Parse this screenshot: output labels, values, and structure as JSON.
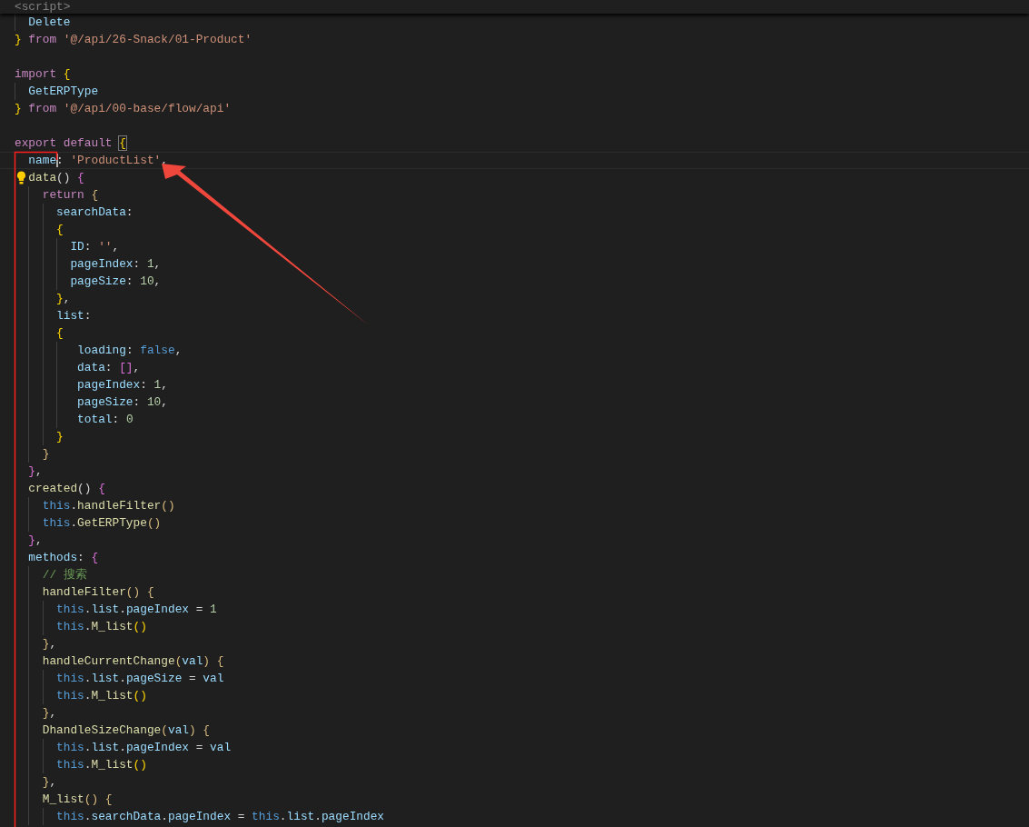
{
  "sticky_header": {
    "t": [
      {
        "kind": "tag",
        "text": "<script>"
      }
    ]
  },
  "lines": [
    {
      "current": false,
      "t": [
        {
          "kind": "property",
          "text": "  Delete"
        }
      ]
    },
    {
      "current": false,
      "t": [
        {
          "kind": "bracket1",
          "text": "}"
        },
        {
          "kind": "keyword",
          "text": " from"
        },
        {
          "kind": "string",
          "text": " '@/api/26-Snack/01-Product'"
        }
      ]
    },
    {
      "current": false
    },
    {
      "current": false,
      "t": [
        {
          "kind": "keyword",
          "text": "import"
        },
        {
          "kind": "bracket1",
          "text": " {"
        }
      ]
    },
    {
      "current": false,
      "t": [
        {
          "kind": "property",
          "text": "  GetERPType"
        }
      ]
    },
    {
      "current": false,
      "t": [
        {
          "kind": "bracket1",
          "text": "}"
        },
        {
          "kind": "keyword",
          "text": " from"
        },
        {
          "kind": "string",
          "text": " '@/api/00-base/flow/api'"
        }
      ]
    },
    {
      "current": false
    },
    {
      "current": false,
      "t": [
        {
          "kind": "keyword",
          "text": "export default "
        },
        {
          "kind": "bracket1",
          "text": "{",
          "match": true
        }
      ]
    },
    {
      "current": true,
      "t": [
        {
          "kind": "property",
          "text": "  name",
          "cursor": true
        },
        {
          "kind": "plain",
          "text": ":"
        },
        {
          "kind": "string",
          "text": " 'ProductList'"
        },
        {
          "kind": "plain",
          "text": ","
        }
      ]
    },
    {
      "current": false,
      "lightbulb": true,
      "t": [
        {
          "kind": "function",
          "text": "  data"
        },
        {
          "kind": "plain",
          "text": "()"
        },
        {
          "kind": "bracket2",
          "text": " {"
        }
      ]
    },
    {
      "current": false,
      "t": [
        {
          "kind": "keyword",
          "text": "    return"
        },
        {
          "kind": "bracket3",
          "text": " {"
        }
      ]
    },
    {
      "current": false,
      "t": [
        {
          "kind": "property",
          "text": "      searchData"
        },
        {
          "kind": "plain",
          "text": ":"
        }
      ]
    },
    {
      "current": false,
      "t": [
        {
          "kind": "bracket1",
          "text": "      {"
        }
      ]
    },
    {
      "current": false,
      "t": [
        {
          "kind": "property",
          "text": "        ID"
        },
        {
          "kind": "plain",
          "text": ":"
        },
        {
          "kind": "string",
          "text": " ''"
        },
        {
          "kind": "plain",
          "text": ","
        }
      ]
    },
    {
      "current": false,
      "t": [
        {
          "kind": "property",
          "text": "        pageIndex"
        },
        {
          "kind": "plain",
          "text": ":"
        },
        {
          "kind": "number",
          "text": " 1"
        },
        {
          "kind": "plain",
          "text": ","
        }
      ]
    },
    {
      "current": false,
      "t": [
        {
          "kind": "property",
          "text": "        pageSize"
        },
        {
          "kind": "plain",
          "text": ":"
        },
        {
          "kind": "number",
          "text": " 10"
        },
        {
          "kind": "plain",
          "text": ","
        }
      ]
    },
    {
      "current": false,
      "t": [
        {
          "kind": "bracket1",
          "text": "      }"
        },
        {
          "kind": "plain",
          "text": ","
        }
      ]
    },
    {
      "current": false,
      "t": [
        {
          "kind": "property",
          "text": "      list"
        },
        {
          "kind": "plain",
          "text": ":"
        }
      ]
    },
    {
      "current": false,
      "t": [
        {
          "kind": "bracket1",
          "text": "      {"
        }
      ]
    },
    {
      "current": false,
      "t": [
        {
          "kind": "property",
          "text": "         loading"
        },
        {
          "kind": "plain",
          "text": ":"
        },
        {
          "kind": "constant",
          "text": " false"
        },
        {
          "kind": "plain",
          "text": ","
        }
      ]
    },
    {
      "current": false,
      "t": [
        {
          "kind": "property",
          "text": "         data"
        },
        {
          "kind": "plain",
          "text": ":"
        },
        {
          "kind": "bracket2",
          "text": " []"
        },
        {
          "kind": "plain",
          "text": ","
        }
      ]
    },
    {
      "current": false,
      "t": [
        {
          "kind": "property",
          "text": "         pageIndex"
        },
        {
          "kind": "plain",
          "text": ":"
        },
        {
          "kind": "number",
          "text": " 1"
        },
        {
          "kind": "plain",
          "text": ","
        }
      ]
    },
    {
      "current": false,
      "t": [
        {
          "kind": "property",
          "text": "         pageSize"
        },
        {
          "kind": "plain",
          "text": ":"
        },
        {
          "kind": "number",
          "text": " 10"
        },
        {
          "kind": "plain",
          "text": ","
        }
      ]
    },
    {
      "current": false,
      "t": [
        {
          "kind": "property",
          "text": "         total"
        },
        {
          "kind": "plain",
          "text": ":"
        },
        {
          "kind": "number",
          "text": " 0"
        }
      ]
    },
    {
      "current": false,
      "t": [
        {
          "kind": "bracket1",
          "text": "      }"
        }
      ]
    },
    {
      "current": false,
      "t": [
        {
          "kind": "bracket3",
          "text": "    }"
        }
      ]
    },
    {
      "current": false,
      "t": [
        {
          "kind": "bracket2",
          "text": "  }"
        },
        {
          "kind": "plain",
          "text": ","
        }
      ]
    },
    {
      "current": false,
      "t": [
        {
          "kind": "function",
          "text": "  created"
        },
        {
          "kind": "plain",
          "text": "()"
        },
        {
          "kind": "bracket2",
          "text": " {"
        }
      ]
    },
    {
      "current": false,
      "t": [
        {
          "kind": "constant",
          "text": "    this"
        },
        {
          "kind": "plain",
          "text": "."
        },
        {
          "kind": "function",
          "text": "handleFilter"
        },
        {
          "kind": "bracket3",
          "text": "()"
        }
      ]
    },
    {
      "current": false,
      "t": [
        {
          "kind": "constant",
          "text": "    this"
        },
        {
          "kind": "plain",
          "text": "."
        },
        {
          "kind": "function",
          "text": "GetERPType"
        },
        {
          "kind": "bracket3",
          "text": "()"
        }
      ]
    },
    {
      "current": false,
      "t": [
        {
          "kind": "bracket2",
          "text": "  }"
        },
        {
          "kind": "plain",
          "text": ","
        }
      ]
    },
    {
      "current": false,
      "t": [
        {
          "kind": "property",
          "text": "  methods"
        },
        {
          "kind": "plain",
          "text": ":"
        },
        {
          "kind": "bracket2",
          "text": " {"
        }
      ]
    },
    {
      "current": false,
      "t": [
        {
          "kind": "comment",
          "text": "    // 搜索"
        }
      ]
    },
    {
      "current": false,
      "t": [
        {
          "kind": "function",
          "text": "    handleFilter"
        },
        {
          "kind": "bracket3",
          "text": "()"
        },
        {
          "kind": "bracket3",
          "text": " {"
        }
      ]
    },
    {
      "current": false,
      "t": [
        {
          "kind": "constant",
          "text": "      this"
        },
        {
          "kind": "plain",
          "text": "."
        },
        {
          "kind": "property",
          "text": "list"
        },
        {
          "kind": "plain",
          "text": "."
        },
        {
          "kind": "property",
          "text": "pageIndex"
        },
        {
          "kind": "plain",
          "text": " ="
        },
        {
          "kind": "number",
          "text": " 1"
        }
      ]
    },
    {
      "current": false,
      "t": [
        {
          "kind": "constant",
          "text": "      this"
        },
        {
          "kind": "plain",
          "text": "."
        },
        {
          "kind": "function",
          "text": "M_list"
        },
        {
          "kind": "bracket1",
          "text": "()"
        }
      ]
    },
    {
      "current": false,
      "t": [
        {
          "kind": "bracket3",
          "text": "    }"
        },
        {
          "kind": "plain",
          "text": ","
        }
      ]
    },
    {
      "current": false,
      "t": [
        {
          "kind": "function",
          "text": "    handleCurrentChange"
        },
        {
          "kind": "bracket3",
          "text": "("
        },
        {
          "kind": "property",
          "text": "val"
        },
        {
          "kind": "bracket3",
          "text": ")"
        },
        {
          "kind": "bracket3",
          "text": " {"
        }
      ]
    },
    {
      "current": false,
      "t": [
        {
          "kind": "constant",
          "text": "      this"
        },
        {
          "kind": "plain",
          "text": "."
        },
        {
          "kind": "property",
          "text": "list"
        },
        {
          "kind": "plain",
          "text": "."
        },
        {
          "kind": "property",
          "text": "pageSize"
        },
        {
          "kind": "plain",
          "text": " ="
        },
        {
          "kind": "property",
          "text": " val"
        }
      ]
    },
    {
      "current": false,
      "t": [
        {
          "kind": "constant",
          "text": "      this"
        },
        {
          "kind": "plain",
          "text": "."
        },
        {
          "kind": "function",
          "text": "M_list"
        },
        {
          "kind": "bracket1",
          "text": "()"
        }
      ]
    },
    {
      "current": false,
      "t": [
        {
          "kind": "bracket3",
          "text": "    }"
        },
        {
          "kind": "plain",
          "text": ","
        }
      ]
    },
    {
      "current": false,
      "t": [
        {
          "kind": "function",
          "text": "    DhandleSizeChange"
        },
        {
          "kind": "bracket3",
          "text": "("
        },
        {
          "kind": "property",
          "text": "val"
        },
        {
          "kind": "bracket3",
          "text": ")"
        },
        {
          "kind": "bracket3",
          "text": " {"
        }
      ]
    },
    {
      "current": false,
      "t": [
        {
          "kind": "constant",
          "text": "      this"
        },
        {
          "kind": "plain",
          "text": "."
        },
        {
          "kind": "property",
          "text": "list"
        },
        {
          "kind": "plain",
          "text": "."
        },
        {
          "kind": "property",
          "text": "pageIndex"
        },
        {
          "kind": "plain",
          "text": " ="
        },
        {
          "kind": "property",
          "text": " val"
        }
      ]
    },
    {
      "current": false,
      "t": [
        {
          "kind": "constant",
          "text": "      this"
        },
        {
          "kind": "plain",
          "text": "."
        },
        {
          "kind": "function",
          "text": "M_list"
        },
        {
          "kind": "bracket1",
          "text": "()"
        }
      ]
    },
    {
      "current": false,
      "t": [
        {
          "kind": "bracket3",
          "text": "    }"
        },
        {
          "kind": "plain",
          "text": ","
        }
      ]
    },
    {
      "current": false,
      "t": [
        {
          "kind": "function",
          "text": "    M_list"
        },
        {
          "kind": "bracket3",
          "text": "()"
        },
        {
          "kind": "bracket3",
          "text": " {"
        }
      ]
    },
    {
      "current": false,
      "t": [
        {
          "kind": "constant",
          "text": "      this"
        },
        {
          "kind": "plain",
          "text": "."
        },
        {
          "kind": "property",
          "text": "searchData"
        },
        {
          "kind": "plain",
          "text": "."
        },
        {
          "kind": "property",
          "text": "pageIndex"
        },
        {
          "kind": "plain",
          "text": " ="
        },
        {
          "kind": "constant",
          "text": " this"
        },
        {
          "kind": "plain",
          "text": "."
        },
        {
          "kind": "property",
          "text": "list"
        },
        {
          "kind": "plain",
          "text": "."
        },
        {
          "kind": "property",
          "text": "pageIndex"
        }
      ]
    }
  ],
  "highlight_box": true,
  "arrow": true
}
